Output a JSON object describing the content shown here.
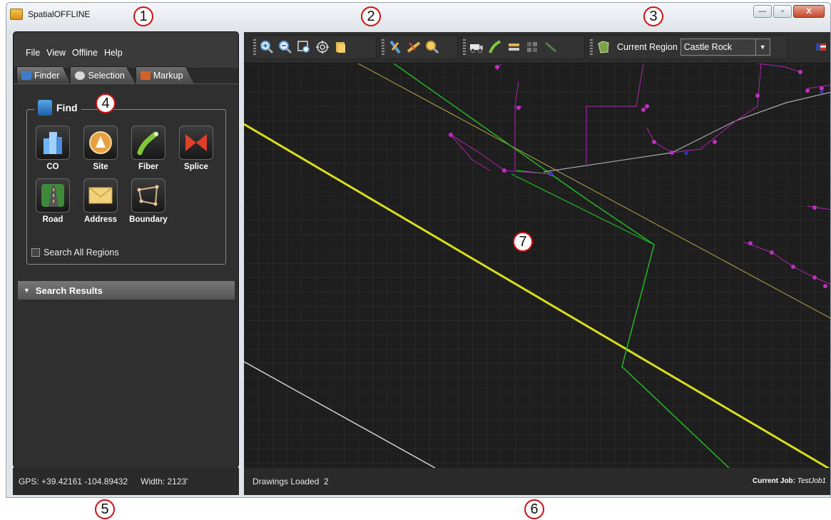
{
  "window": {
    "title": "SpatialOFFLINE",
    "minimize": "—",
    "maximize": "▫",
    "close": "X"
  },
  "menu": [
    "File",
    "View",
    "Offline",
    "Help"
  ],
  "tabs": [
    {
      "label": "Finder",
      "icon": "finder-icon",
      "color": "#3d7cc9"
    },
    {
      "label": "Selection",
      "icon": "cursor-icon",
      "color": "#cfcfcf"
    },
    {
      "label": "Markup",
      "icon": "markup-icon",
      "color": "#d4622a"
    }
  ],
  "finder": {
    "title": "Find",
    "buttons": [
      {
        "label": "CO",
        "icon": "building-icon"
      },
      {
        "label": "Site",
        "icon": "site-icon"
      },
      {
        "label": "Fiber",
        "icon": "fiber-icon"
      },
      {
        "label": "Splice",
        "icon": "splice-icon"
      },
      {
        "label": "Road",
        "icon": "road-icon"
      },
      {
        "label": "Address",
        "icon": "envelope-icon"
      },
      {
        "label": "Boundary",
        "icon": "boundary-icon"
      }
    ],
    "search_all_regions": "Search All Regions",
    "search_all_checked": false
  },
  "search_results": {
    "label": "Search Results"
  },
  "status": {
    "gps": "GPS: +39.42161 -104.89432",
    "width": "Width: 2123'",
    "drawings": "Drawings Loaded  2",
    "job_label": "Current Job:",
    "job_value": "TestJob1"
  },
  "region": {
    "label": "Current Region",
    "value": "Castle Rock"
  },
  "callouts": [
    "1",
    "2",
    "3",
    "4",
    "5",
    "6",
    "7"
  ],
  "colors": {
    "road_yellow": "#d8dd1f",
    "fiber_green": "#23b823",
    "tan_line": "#b5a64a",
    "magenta_line": "#b023b0",
    "white_line": "#d0d0d0"
  }
}
